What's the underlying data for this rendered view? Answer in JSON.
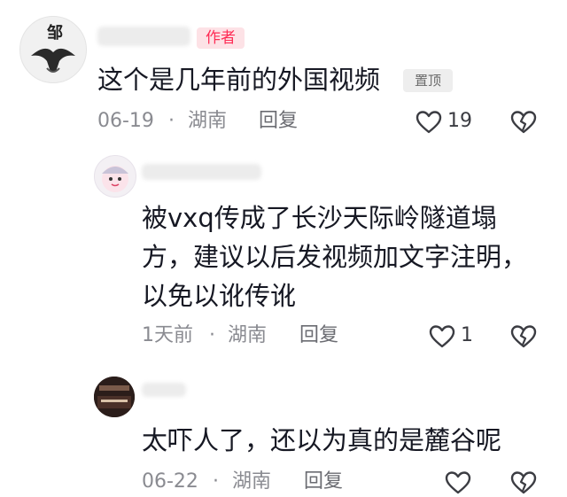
{
  "comments": [
    {
      "author_badge": "作者",
      "pinned_label": "置顶",
      "text": "这个是几年前的外国视频",
      "date": "06-19",
      "separator": "·",
      "location": "湖南",
      "reply_label": "回复",
      "like_count": "19"
    },
    {
      "text_lines": [
        "被vxq传成了长沙天际岭隧道塌",
        "方，建议以后发视频加文字注明，",
        "以免以讹传讹"
      ],
      "date": "1天前",
      "separator": "·",
      "location": "湖南",
      "reply_label": "回复",
      "like_count": "1"
    },
    {
      "text": "太吓人了，还以为真的是麓谷呢",
      "date": "06-22",
      "separator": "·",
      "location": "湖南",
      "reply_label": "回复",
      "like_count": ""
    }
  ],
  "avatar_logo_text": "邹",
  "icons": [
    "heart-outline-icon",
    "broken-heart-icon"
  ],
  "colors": {
    "accent": "#fe2c55",
    "badge_bg": "#fde2e6",
    "meta": "#8a8b91"
  }
}
